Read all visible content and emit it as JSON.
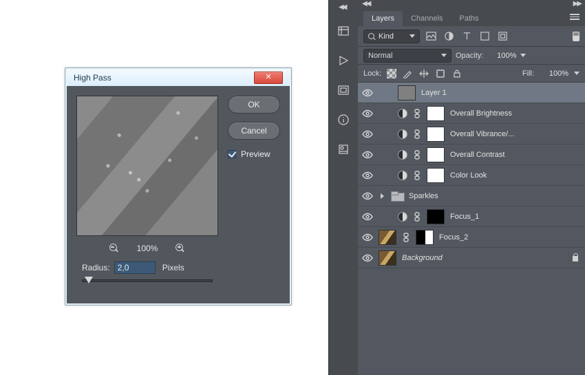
{
  "dialog": {
    "title": "High Pass",
    "close_glyph": "✕",
    "ok_label": "OK",
    "cancel_label": "Cancel",
    "preview_label": "Preview",
    "preview_checked": true,
    "zoom_text": "100%",
    "radius_label": "Radius:",
    "radius_value": "2,0",
    "radius_units": "Pixels"
  },
  "panel": {
    "collapse_left": "◀◀",
    "collapse_right": "▶▶",
    "tabs": {
      "layers": "Layers",
      "channels": "Channels",
      "paths": "Paths"
    },
    "filter_kind": "Kind",
    "blend_mode": "Normal",
    "opacity_label": "Opacity:",
    "opacity_value": "100%",
    "lock_label": "Lock:",
    "fill_label": "Fill:",
    "fill_value": "100%",
    "layers": [
      {
        "name": "Layer 1",
        "kind": "pixel-gray",
        "selected": true
      },
      {
        "name": "Overall Brightness",
        "kind": "adj"
      },
      {
        "name": "Overall Vibrance/...",
        "kind": "adj"
      },
      {
        "name": "Overall Contrast",
        "kind": "adj"
      },
      {
        "name": "Color Look",
        "kind": "adj"
      },
      {
        "name": "Sparkles",
        "kind": "group"
      },
      {
        "name": "Focus_1",
        "kind": "adj-blackmask"
      },
      {
        "name": "Focus_2",
        "kind": "img-halfmask"
      },
      {
        "name": "Background",
        "kind": "bg",
        "locked": true,
        "italic": true
      }
    ]
  }
}
